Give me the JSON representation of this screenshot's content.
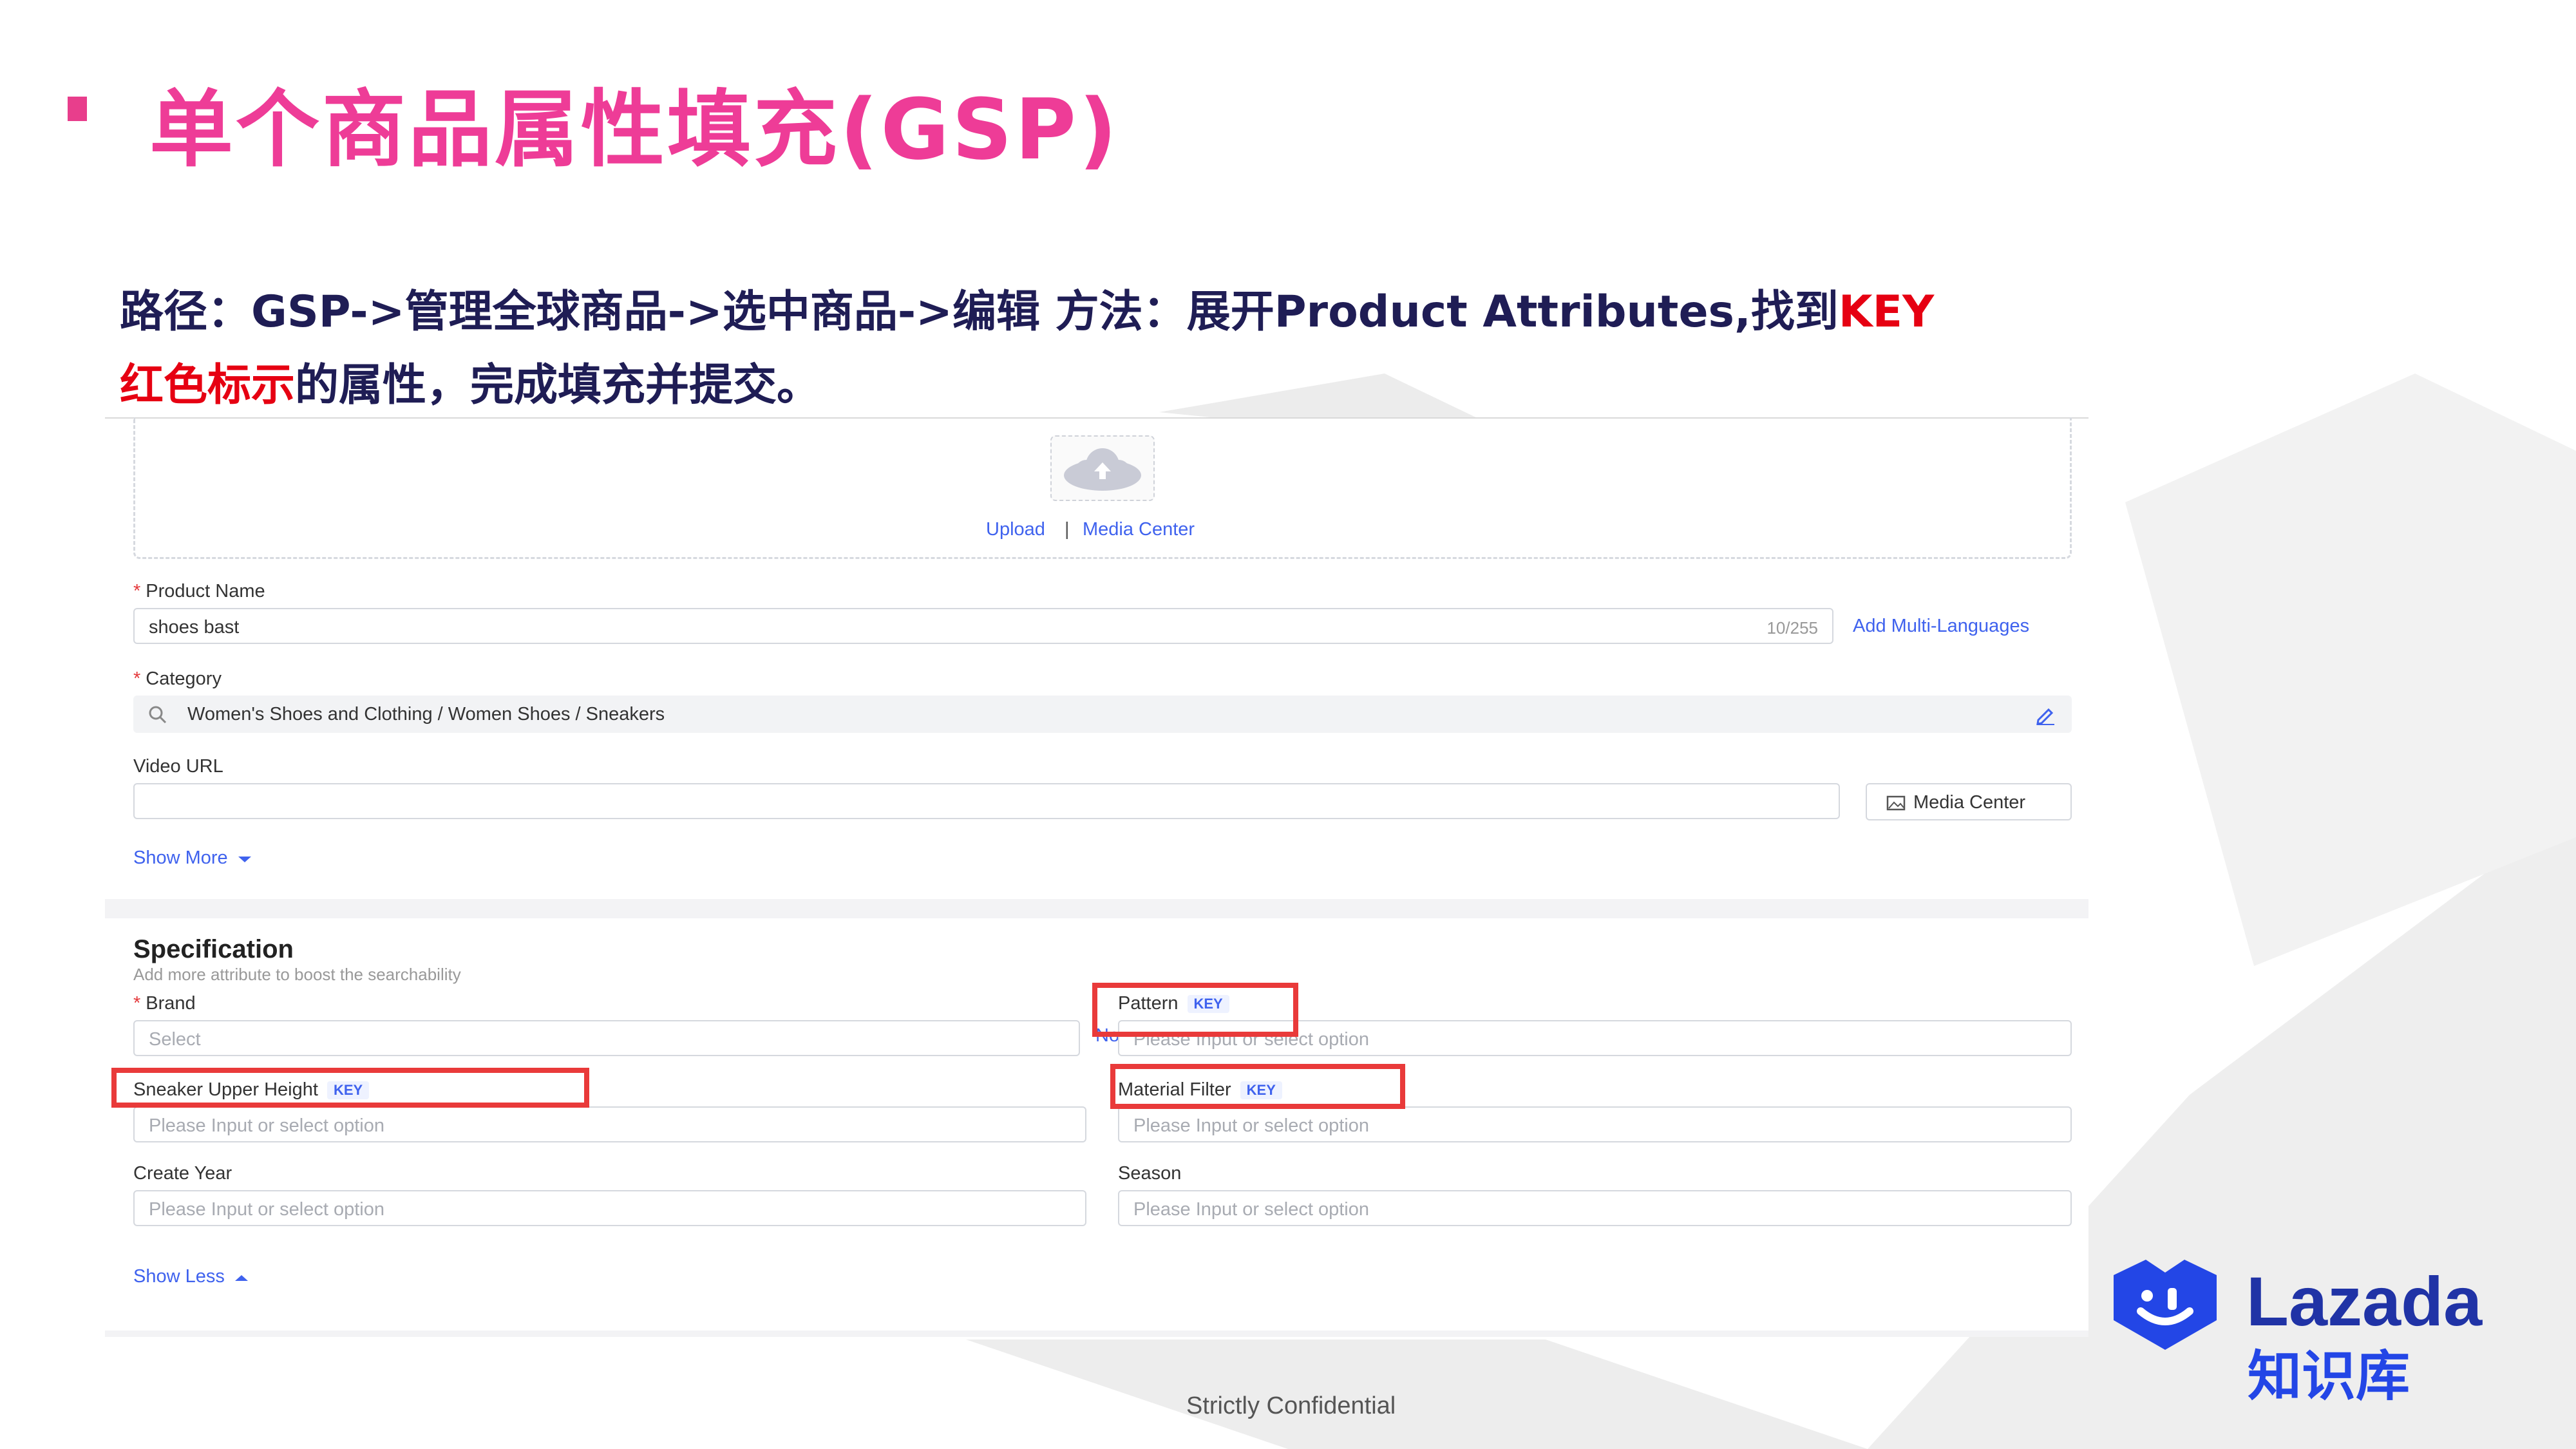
{
  "slide": {
    "title": "单个商品属性填充(GSP)",
    "instruction": {
      "line1_part1": "路径：GSP->管理全球商品->选中商品->编辑 方法：展开Product Attributes,找到",
      "line1_key": "KEY",
      "line2_red": "红色标示",
      "line2_rest": "的属性，完成填充并提交。"
    },
    "footer": "Strictly Confidential",
    "logo": {
      "word": "Lazada",
      "sub": "知识库"
    }
  },
  "screenshot": {
    "upload": {
      "upload_link": "Upload",
      "separator": "|",
      "media_center_link": "Media Center"
    },
    "product_name": {
      "label": "Product Name",
      "value": "shoes bast",
      "counter": "10/255",
      "multi_lang_link": "Add Multi-Languages"
    },
    "category": {
      "label": "Category",
      "value": "Women's Shoes and Clothing / Women Shoes / Sneakers"
    },
    "video_url": {
      "label": "Video URL",
      "media_center_button": "Media Center"
    },
    "show_more": "Show More",
    "specification": {
      "title": "Specification",
      "subtitle": "Add more attribute to boost the searchability",
      "brand": {
        "label": "Brand",
        "placeholder": "Select",
        "no_brand_link": "No Brand"
      },
      "pattern": {
        "label": "Pattern",
        "key": "KEY",
        "placeholder": "Please Input or select option"
      },
      "sneaker_upper_height": {
        "label": "Sneaker Upper Height",
        "key": "KEY",
        "placeholder": "Please Input or select option"
      },
      "material_filter": {
        "label": "Material Filter",
        "key": "KEY",
        "placeholder": "Please Input or select option"
      },
      "create_year": {
        "label": "Create Year",
        "placeholder": "Please Input or select option"
      },
      "season": {
        "label": "Season",
        "placeholder": "Please Input or select option"
      },
      "show_less": "Show Less"
    }
  },
  "colors": {
    "title_pink": "#ee3c97",
    "instruction_navy": "#1f1d55",
    "key_red": "#e60012",
    "link_blue": "#3f62ee",
    "highlight_red": "#e93a3a",
    "logo_blue": "#2346e6"
  }
}
